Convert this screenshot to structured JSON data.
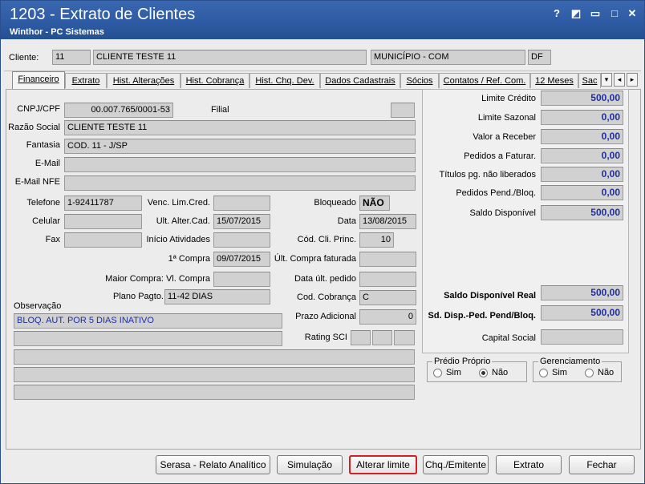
{
  "window": {
    "title": "1203 - Extrato de Clientes",
    "subtitle": "Winthor - PC Sistemas",
    "controls": {
      "help": "?",
      "restore_dock": "◩",
      "minimize": "▭",
      "maximize": "□",
      "close": "✕"
    }
  },
  "client": {
    "label": "Cliente:",
    "code": "11",
    "name": "CLIENTE TESTE 11",
    "city": "MUNICÍPIO - COM",
    "state": "DF"
  },
  "tabs": [
    {
      "label": "Financeiro"
    },
    {
      "label": "Extrato"
    },
    {
      "label": "Hist. Alterações"
    },
    {
      "label": "Hist. Cobrança"
    },
    {
      "label": "Hist. Chq. Dev."
    },
    {
      "label": "Dados Cadastrais"
    },
    {
      "label": "Sócios"
    },
    {
      "label": "Contatos / Ref. Com."
    },
    {
      "label": "12 Meses"
    },
    {
      "label": "Sac"
    }
  ],
  "tab_scroll": {
    "left": "◂",
    "right": "▸",
    "dropdown": "▾"
  },
  "form": {
    "cnpj": {
      "label": "CNPJ/CPF",
      "value": "00.007.765/0001-53"
    },
    "filial": {
      "label": "Filial",
      "value": ""
    },
    "razao": {
      "label": "Razão Social",
      "value": "CLIENTE TESTE 11"
    },
    "fantasia": {
      "label": "Fantasia",
      "value": "COD. 11 - J/SP"
    },
    "email": {
      "label": "E-Mail",
      "value": ""
    },
    "email_nfe": {
      "label": "E-Mail NFE",
      "value": ""
    },
    "telefone": {
      "label": "Telefone",
      "value": "1-92411787"
    },
    "venc_lim": {
      "label": "Venc. Lim.Cred.",
      "value": ""
    },
    "bloqueado": {
      "label": "Bloqueado",
      "value": "NÃO"
    },
    "celular": {
      "label": "Celular",
      "value": ""
    },
    "ult_alter": {
      "label": "Ult. Alter.Cad.",
      "value": "15/07/2015"
    },
    "data": {
      "label": "Data",
      "value": "13/08/2015"
    },
    "fax": {
      "label": "Fax",
      "value": ""
    },
    "inicio": {
      "label": "Início Atividades",
      "value": ""
    },
    "cod_cli_princ": {
      "label": "Cód. Cli. Princ.",
      "value": "10"
    },
    "primeira_compra": {
      "label": "1ª Compra",
      "value": "09/07/2015"
    },
    "ult_compra": {
      "label": "Últ. Compra faturada",
      "value": ""
    },
    "maior_compra": {
      "label": "Maior Compra: Vl. Compra",
      "value": ""
    },
    "data_ult_pedido": {
      "label": "Data últ. pedido",
      "value": ""
    },
    "plano_pagto": {
      "label": "Plano Pagto.",
      "value": "11-42 DIAS"
    },
    "cod_cobranca": {
      "label": "Cod. Cobrança",
      "value": "C"
    },
    "observacao": {
      "label": "Observação",
      "lines": [
        "BLOQ. AUT. POR 5 DIAS INATIVO",
        "",
        "",
        "",
        ""
      ]
    },
    "prazo_adicional": {
      "label": "Prazo Adicional",
      "value": "0"
    },
    "rating_sci": {
      "label": "Rating SCI",
      "values": [
        "",
        "",
        ""
      ]
    }
  },
  "finance": {
    "limite_credito": {
      "label": "Limite Crédito",
      "value": "500,00"
    },
    "limite_sazonal": {
      "label": "Limite Sazonal",
      "value": "0,00"
    },
    "valor_receber": {
      "label": "Valor a Receber",
      "value": "0,00"
    },
    "pedidos_faturar": {
      "label": "Pedidos a Faturar.",
      "value": "0,00"
    },
    "titulos_nao_lib": {
      "label": "Títulos pg. não liberados",
      "value": "0,00"
    },
    "pedidos_pend": {
      "label": "Pedidos Pend./Bloq.",
      "value": "0,00"
    },
    "saldo_disponivel": {
      "label": "Saldo Disponível",
      "value": "500,00"
    },
    "saldo_real": {
      "label": "Saldo Disponível Real",
      "value": "500,00"
    },
    "sd_disp_ped": {
      "label": "Sd. Disp.-Ped. Pend/Bloq.",
      "value": "500,00"
    },
    "capital_social": {
      "label": "Capital Social",
      "value": ""
    }
  },
  "predio_proprio": {
    "label": "Prédio Próprio",
    "sim": "Sim",
    "nao": "Não",
    "selected": "Não"
  },
  "gerenciamento": {
    "label": "Gerenciamento",
    "sim": "Sim",
    "nao": "Não",
    "selected": ""
  },
  "buttons": {
    "serasa": "Serasa - Relato Analítico",
    "simulacao": "Simulação",
    "alterar_limite": "Alterar limite",
    "chq_emitente": "Chq./Emitente",
    "extrato": "Extrato",
    "fechar": "Fechar"
  },
  "colors": {
    "titlebar": "#2d5aa3",
    "highlight": "#d2202a",
    "value_text": "#1f2f9a"
  }
}
